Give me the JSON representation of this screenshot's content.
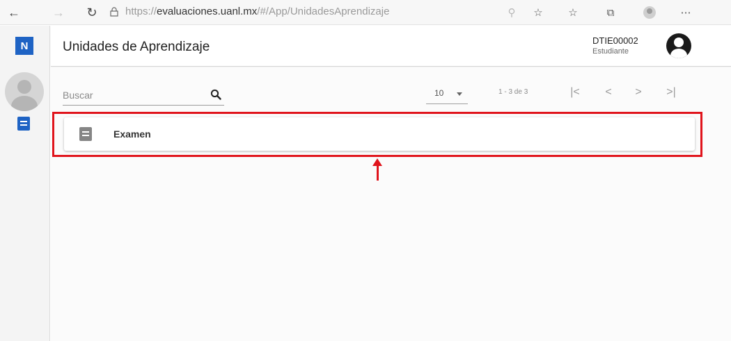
{
  "browser": {
    "url_prefix": "https://",
    "url_host": "evaluaciones.uanl.mx",
    "url_path": "/#/App/UnidadesAprendizaje",
    "icons": [
      "back-arrow-icon",
      "forward-arrow-icon",
      "reload-icon",
      "lock-icon",
      "key-icon",
      "favorite-star-icon",
      "favorites-list-icon",
      "collections-icon",
      "profile-icon",
      "more-icon"
    ]
  },
  "rail": {
    "logo_text": "N",
    "icons": [
      "user-avatar-icon",
      "book-icon"
    ],
    "accent_color": "#1e63c4"
  },
  "header": {
    "title": "Unidades de Aprendizaje",
    "user_code": "DTIE00002",
    "user_role": "Estudiante"
  },
  "toolbar": {
    "search_placeholder": "Buscar",
    "per_page": "10",
    "range": "1 - 3 de 3",
    "pager": {
      "first": "|<",
      "prev": "<",
      "next": ">",
      "last": ">|"
    }
  },
  "items": [
    {
      "label": "Examen",
      "icon": "book-icon"
    }
  ],
  "annotation": {
    "color": "#e0141c"
  }
}
